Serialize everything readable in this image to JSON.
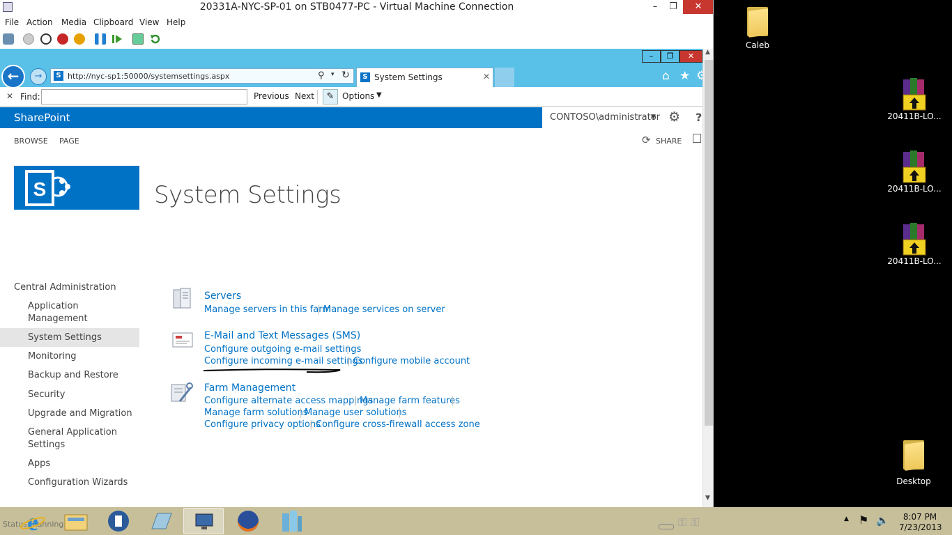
{
  "vm": {
    "title": "20331A-NYC-SP-01 on STB0477-PC - Virtual Machine Connection",
    "menu": [
      "File",
      "Action",
      "Media",
      "Clipboard",
      "View",
      "Help"
    ]
  },
  "browser": {
    "url": "http://nyc-sp1:50000/systemsettings.aspx",
    "tab_title": "System Settings",
    "find_label": "Find:",
    "find_value": "",
    "previous_label": "Previous",
    "next_label": "Next",
    "options_label": "Options",
    "status_text": "Status: Running"
  },
  "sharepoint": {
    "brand": "SharePoint",
    "user": "CONTOSO\\administrator",
    "ribbon_tabs": [
      "BROWSE",
      "PAGE"
    ],
    "share_label": "SHARE",
    "page_title": "System Settings",
    "quick_launch": {
      "root": "Central Administration",
      "items": [
        "Application Management",
        "System Settings",
        "Monitoring",
        "Backup and Restore",
        "Security",
        "Upgrade and Migration",
        "General Application Settings",
        "Apps",
        "Configuration Wizards"
      ],
      "selected": "System Settings"
    },
    "sections": [
      {
        "title": "Servers",
        "links": [
          "Manage servers in this farm",
          "Manage services on server"
        ]
      },
      {
        "title": "E-Mail and Text Messages (SMS)",
        "links": [
          "Configure outgoing e-mail settings",
          "Configure incoming e-mail settings",
          "Configure mobile account"
        ]
      },
      {
        "title": "Farm Management",
        "links": [
          "Configure alternate access mappings",
          "Manage farm features",
          "Manage farm solutions",
          "Manage user solutions",
          "Configure privacy options",
          "Configure cross-firewall access zone"
        ]
      }
    ]
  },
  "desktop": {
    "icons": [
      "Caleb",
      "20411B-LO...",
      "20411B-LO...",
      "20411B-LO...",
      "Desktop"
    ]
  },
  "taskbar": {
    "time": "8:07 PM",
    "date": "7/23/2013"
  },
  "colors": {
    "sharepoint_blue": "#0072c6",
    "ie_frame": "#59c0e8",
    "taskbar": "#c6bf9a"
  }
}
